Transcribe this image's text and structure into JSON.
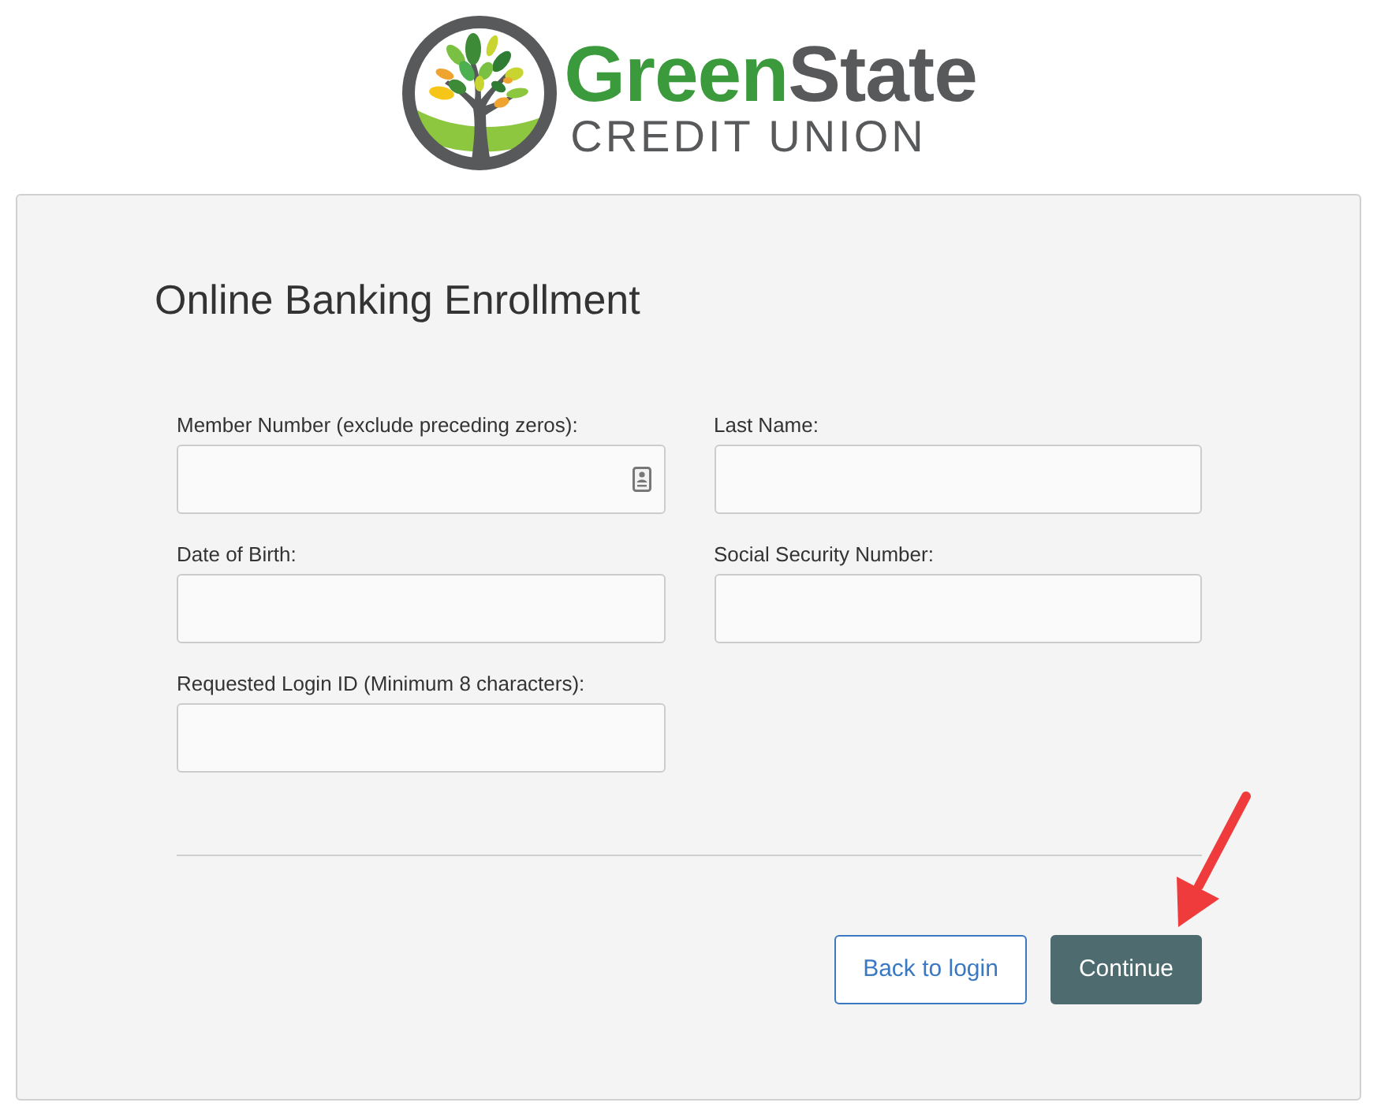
{
  "logo": {
    "name_first": "Green",
    "name_second": "State",
    "tagline": "CREDIT UNION"
  },
  "form": {
    "title": "Online Banking Enrollment",
    "fields": [
      {
        "label": "Member Number (exclude preceding zeros):",
        "autofill_icon": true
      },
      {
        "label": "Last Name:",
        "autofill_icon": false
      },
      {
        "label": "Date of Birth:",
        "autofill_icon": false
      },
      {
        "label": "Social Security Number:",
        "autofill_icon": false
      },
      {
        "label": "Requested Login ID (Minimum 8 characters):",
        "autofill_icon": false
      }
    ]
  },
  "buttons": [
    {
      "label": "Back to login",
      "kind": "secondary"
    },
    {
      "label": "Continue",
      "kind": "primary"
    }
  ]
}
